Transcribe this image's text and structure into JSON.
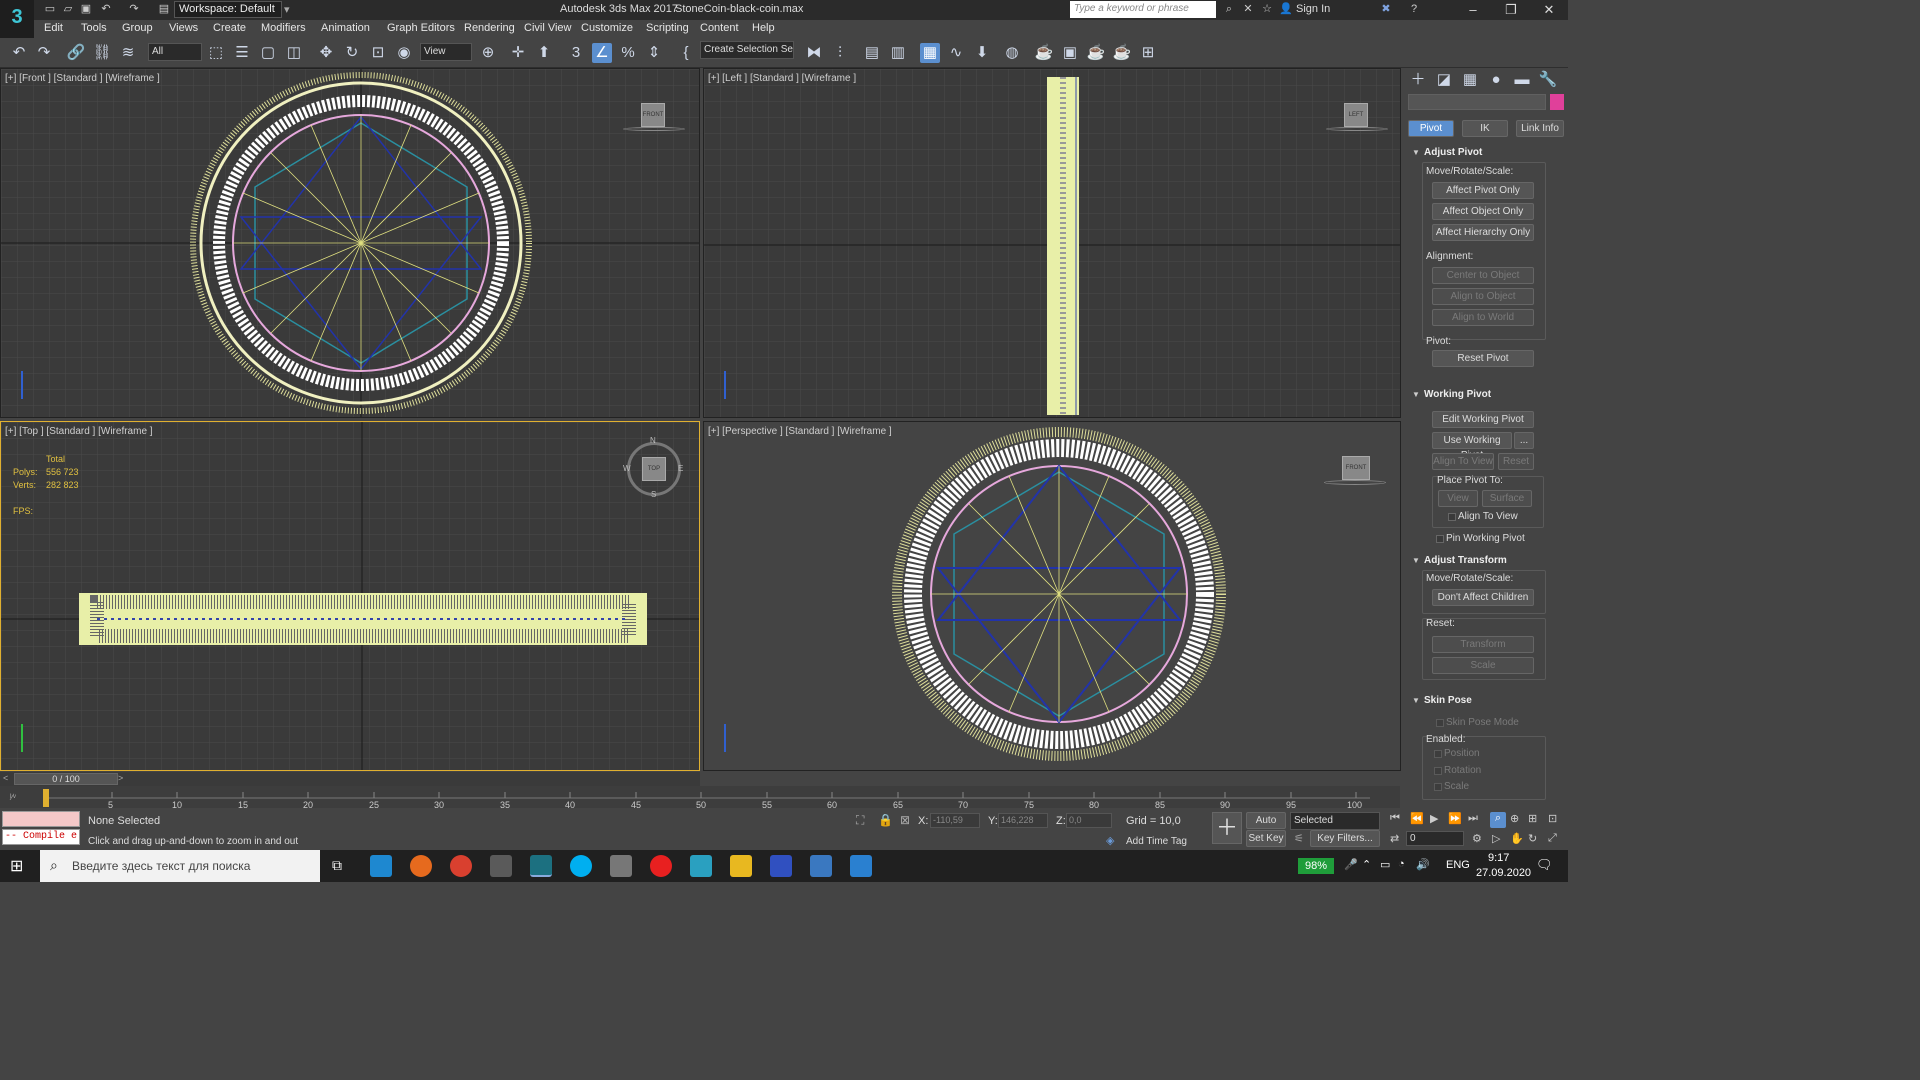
{
  "app": {
    "logo": "3",
    "title": "Autodesk 3ds Max 2017",
    "file": "StoneCoin-black-coin.max",
    "workspace": "Workspace: Default",
    "search_placeholder": "Type a keyword or phrase",
    "sign_in": "Sign In"
  },
  "menu": [
    "Edit",
    "Tools",
    "Group",
    "Views",
    "Create",
    "Modifiers",
    "Animation",
    "Graph Editors",
    "Rendering",
    "Civil View",
    "Customize",
    "Scripting",
    "Content",
    "Help"
  ],
  "toolbar": {
    "filter": "All",
    "ref_coord": "View",
    "selection_set": "Create Selection Se"
  },
  "viewports": {
    "front": "[+] [Front ] [Standard ] [Wireframe ]",
    "left": "[+] [Left ] [Standard ] [Wireframe ]",
    "top": "[+] [Top ] [Standard ] [Wireframe ]",
    "perspective": "[+] [Perspective ] [Standard ] [Wireframe ]",
    "stats": {
      "total_label": "Total",
      "polys_label": "Polys:",
      "polys": "556 723",
      "verts_label": "Verts:",
      "verts": "282 823",
      "fps_label": "FPS:"
    },
    "compass": {
      "n": "N",
      "s": "S",
      "w": "W",
      "e": "E",
      "cube": "TOP"
    },
    "viewcube_front": "FRONT",
    "viewcube_left": "LEFT",
    "viewcube_persp": "FRONT"
  },
  "command_panel": {
    "tabs": [
      "Pivot",
      "IK",
      "Link Info"
    ],
    "adjust_pivot": {
      "title": "Adjust Pivot",
      "mrs_label": "Move/Rotate/Scale:",
      "buttons": [
        "Affect Pivot Only",
        "Affect Object Only",
        "Affect Hierarchy Only"
      ],
      "alignment_label": "Alignment:",
      "align_buttons": [
        "Center to Object",
        "Align to Object",
        "Align to World"
      ],
      "pivot_label": "Pivot:",
      "reset": "Reset Pivot"
    },
    "working_pivot": {
      "title": "Working Pivot",
      "edit": "Edit Working Pivot",
      "use": "Use Working Pivot",
      "more": "...",
      "align_view": "Align To View",
      "reset": "Reset",
      "place_label": "Place Pivot To:",
      "view": "View",
      "surface": "Surface",
      "align_to_view": "Align To View",
      "pin": "Pin Working Pivot"
    },
    "adjust_transform": {
      "title": "Adjust Transform",
      "mrs_label": "Move/Rotate/Scale:",
      "dont_affect": "Don't Affect Children",
      "reset_label": "Reset:",
      "transform": "Transform",
      "scale": "Scale"
    },
    "skin_pose": {
      "title": "Skin Pose",
      "mode": "Skin Pose Mode",
      "enabled_label": "Enabled:",
      "position": "Position",
      "rotation": "Rotation",
      "scale": "Scale"
    }
  },
  "timeline": {
    "frame": "0 / 100",
    "ticks": [
      "5",
      "10",
      "15",
      "20",
      "25",
      "30",
      "35",
      "40",
      "45",
      "50",
      "55",
      "60",
      "65",
      "70",
      "75",
      "80",
      "85",
      "90",
      "95",
      "100"
    ]
  },
  "status": {
    "compile": "-- Compile e",
    "selection": "None Selected",
    "hint": "Click and drag up-and-down to zoom in and out",
    "x_label": "X:",
    "x": "-110,59",
    "y_label": "Y:",
    "y": "146,228",
    "z_label": "Z:",
    "z": "0,0",
    "grid": "Grid = 10,0",
    "add_time_tag": "Add Time Tag",
    "auto_key": "Auto Key",
    "set_key": "Set Key",
    "key_mode": "Selected",
    "key_filters": "Key Filters...",
    "frame_field": "0"
  },
  "taskbar": {
    "search": "Введите здесь текст для поиска",
    "battery": "98%",
    "lang": "ENG",
    "time": "9:17",
    "date": "27.09.2020"
  }
}
